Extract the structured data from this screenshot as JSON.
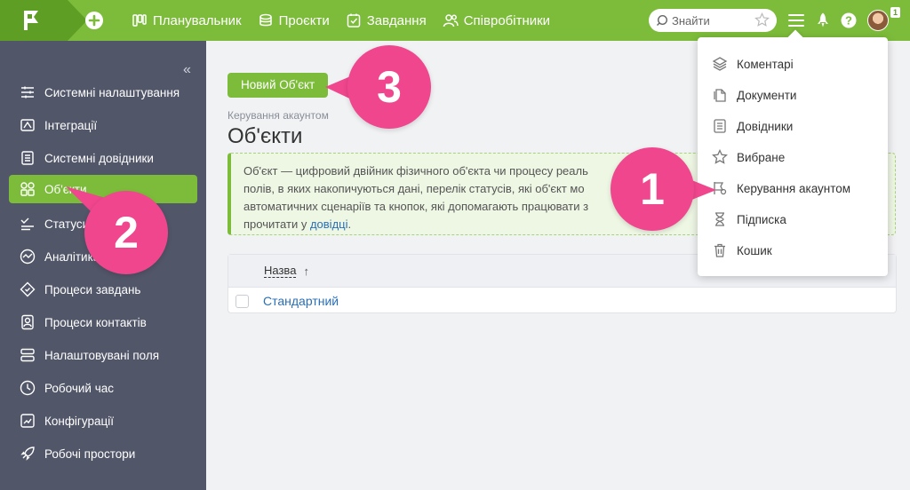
{
  "topnav": {
    "items": [
      {
        "label": "Планувальник",
        "icon": "planner-icon"
      },
      {
        "label": "Проєкти",
        "icon": "projects-icon"
      },
      {
        "label": "Завдання",
        "icon": "tasks-icon"
      },
      {
        "label": "Співробітники",
        "icon": "employees-icon"
      }
    ],
    "search_placeholder": "Знайти",
    "notification_count": "1"
  },
  "sidebar": {
    "items": [
      {
        "label": "Системні налаштування"
      },
      {
        "label": "Інтеграції"
      },
      {
        "label": "Системні довідники"
      },
      {
        "label": "Об'єкти",
        "active": true
      },
      {
        "label": "Статуси"
      },
      {
        "label": "Аналітика"
      },
      {
        "label": "Процеси завдань"
      },
      {
        "label": "Процеси контактів"
      },
      {
        "label": "Налаштовувані поля"
      },
      {
        "label": "Робочий час"
      },
      {
        "label": "Конфігурації"
      },
      {
        "label": "Робочі простори"
      }
    ]
  },
  "main": {
    "new_button": "Новий Об'єкт",
    "breadcrumb": "Керування акаунтом",
    "title": "Об'єкти",
    "info_text_1": "Об'єкт — цифровий двійник фізичного об'єкта чи процесу реаль",
    "info_text_2": "полів, в яких накопичуються дані, перелік статусів, які об'єкт мо",
    "info_text_3": "автоматичних сценаріїв та кнопок, які допомагають працювати з",
    "info_text_4": "прочитати у ",
    "info_link": "довідці",
    "info_text_end": ".",
    "table": {
      "column_name": "Назва",
      "sort_indicator": "↑",
      "rows": [
        {
          "name": "Стандартний"
        }
      ]
    }
  },
  "dropdown": {
    "items": [
      {
        "label": "Коментарі"
      },
      {
        "label": "Документи"
      },
      {
        "label": "Довідники"
      },
      {
        "label": "Вибране"
      },
      {
        "label": "Керування акаунтом"
      },
      {
        "label": "Підписка"
      },
      {
        "label": "Кошик"
      }
    ]
  },
  "callouts": {
    "one": "1",
    "two": "2",
    "three": "3"
  },
  "colors": {
    "brand_green": "#7cbc3a",
    "dark_green": "#5f9e25",
    "sidebar_bg": "#525669",
    "callout_pink": "#f0468d",
    "link_blue": "#2a6fb5"
  }
}
